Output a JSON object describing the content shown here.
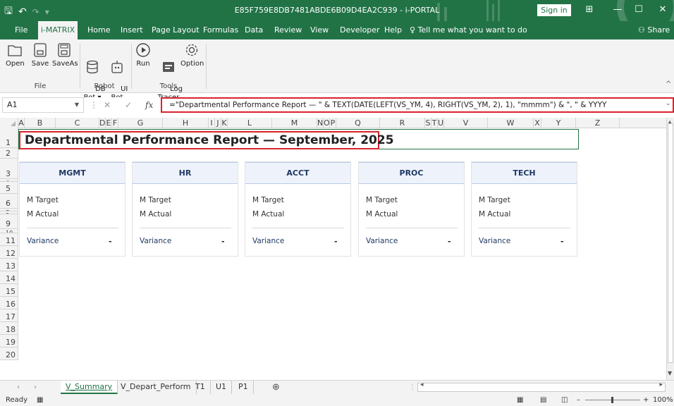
{
  "titlebar": {
    "document_title": "E85F759E8DB7481ABDE6B09D4EA2C939  -  i-PORTAL",
    "sign_in_label": "Sign in"
  },
  "menu_tabs": [
    {
      "label": "File"
    },
    {
      "label": "i-MATRIX"
    },
    {
      "label": "Home"
    },
    {
      "label": "Insert"
    },
    {
      "label": "Page Layout"
    },
    {
      "label": "Formulas"
    },
    {
      "label": "Data"
    },
    {
      "label": "Review"
    },
    {
      "label": "View"
    },
    {
      "label": "Developer"
    },
    {
      "label": "Help"
    }
  ],
  "tell_me": "Tell me what you want to do",
  "share_label": "Share",
  "ribbon": {
    "buttons": [
      {
        "label": "Open",
        "icon": "folder-icon"
      },
      {
        "label": "Save",
        "icon": "save-icon"
      },
      {
        "label": "SaveAs",
        "icon": "save-as-icon"
      },
      {
        "label": "DB\nBot ▾",
        "icon": "database-icon"
      },
      {
        "label": "UI\nBot",
        "icon": "robot-icon"
      },
      {
        "label": "Run",
        "icon": "play-icon"
      },
      {
        "label": "Log\nTracer",
        "icon": "log-icon"
      },
      {
        "label": "Option",
        "icon": "gear-icon"
      }
    ],
    "groups": [
      {
        "label": "File"
      },
      {
        "label": "Robot"
      },
      {
        "label": "Tools"
      }
    ]
  },
  "formula_bar": {
    "name_box": "A1",
    "fx": "fx",
    "formula": "=\"Departmental Performance Report — \" & TEXT(DATE(LEFT(VS_YM, 4), RIGHT(VS_YM, 2), 1), \"mmmm\") & \", \" & YYYY"
  },
  "columns": [
    "A",
    "B",
    "C",
    "D",
    "E",
    "F",
    "G",
    "H",
    "I",
    "J",
    "K",
    "L",
    "M",
    "N",
    "O",
    "P",
    "Q",
    "R",
    "S",
    "T",
    "U",
    "V",
    "W",
    "X",
    "Y",
    "Z"
  ],
  "rows": [
    "1",
    "2",
    "3",
    "4",
    "5",
    "6",
    "7",
    "8",
    "9",
    "10",
    "11",
    "12",
    "13",
    "14",
    "15",
    "16",
    "17",
    "18",
    "19",
    "20"
  ],
  "report_title": "Departmental Performance Report — September, 2025",
  "cards": [
    {
      "dept": "MGMT",
      "target_label": "M Target",
      "actual_label": "M Actual",
      "variance_label": "Variance",
      "variance_value": "-"
    },
    {
      "dept": "HR",
      "target_label": "M Target",
      "actual_label": "M Actual",
      "variance_label": "Variance",
      "variance_value": "-"
    },
    {
      "dept": "ACCT",
      "target_label": "M Target",
      "actual_label": "M Actual",
      "variance_label": "Variance",
      "variance_value": "-"
    },
    {
      "dept": "PROC",
      "target_label": "M Target",
      "actual_label": "M Actual",
      "variance_label": "Variance",
      "variance_value": "-"
    },
    {
      "dept": "TECH",
      "target_label": "M Target",
      "actual_label": "M Actual",
      "variance_label": "Variance",
      "variance_value": "-"
    }
  ],
  "sheet_tabs": [
    {
      "label": "V_Summary",
      "active": true
    },
    {
      "label": "V_Depart_Perform"
    },
    {
      "label": "T1"
    },
    {
      "label": "U1"
    },
    {
      "label": "P1"
    }
  ],
  "status": {
    "ready": "Ready",
    "zoom": "100%"
  },
  "colors": {
    "brand": "#217346",
    "highlight": "#d9232e",
    "card_header": "#1f3864"
  }
}
